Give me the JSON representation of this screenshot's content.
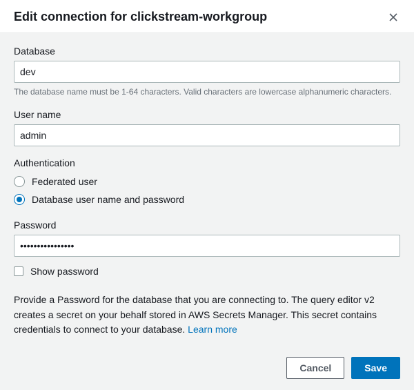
{
  "header": {
    "title": "Edit connection for clickstream-workgroup"
  },
  "fields": {
    "database": {
      "label": "Database",
      "value": "dev",
      "helper": "The database name must be 1-64 characters. Valid characters are lowercase alphanumeric characters."
    },
    "username": {
      "label": "User name",
      "value": "admin"
    },
    "authentication": {
      "label": "Authentication",
      "options": {
        "federated": "Federated user",
        "dbuser": "Database user name and password"
      }
    },
    "password": {
      "label": "Password",
      "value": "••••••••••••••••",
      "show_label": "Show password"
    }
  },
  "info": {
    "text": "Provide a Password for the database that you are connecting to. The query editor v2 creates a secret on your behalf stored in AWS Secrets Manager. This secret contains credentials to connect to your database. ",
    "link": "Learn more"
  },
  "footer": {
    "cancel": "Cancel",
    "save": "Save"
  }
}
